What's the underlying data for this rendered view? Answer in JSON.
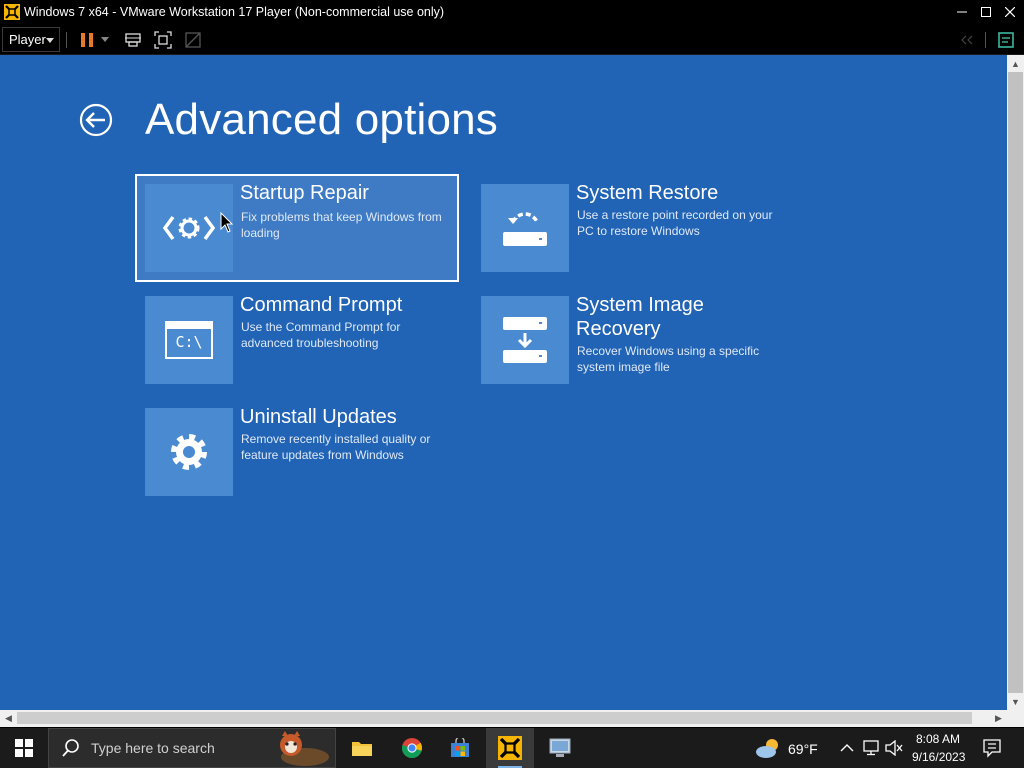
{
  "window": {
    "title": "Windows 7 x64 - VMware Workstation 17 Player (Non-commercial use only)"
  },
  "toolbar": {
    "player_label": "Player"
  },
  "screen": {
    "title": "Advanced options",
    "tiles": [
      {
        "title": "Startup Repair",
        "desc": "Fix problems that keep Windows from loading",
        "icon": "startup-repair-icon"
      },
      {
        "title": "System Restore",
        "desc": "Use a restore point recorded on your PC to restore Windows",
        "icon": "system-restore-icon"
      },
      {
        "title": "Command Prompt",
        "desc": "Use the Command Prompt for advanced troubleshooting",
        "icon": "command-prompt-icon",
        "icon_text": "C:\\"
      },
      {
        "title": "System Image Recovery",
        "desc": "Recover Windows using a specific system image file",
        "icon": "system-image-icon"
      },
      {
        "title": "Uninstall Updates",
        "desc": "Remove recently installed quality or feature updates from Windows",
        "icon": "gear-icon"
      }
    ]
  },
  "taskbar": {
    "search_placeholder": "Type here to search",
    "weather": "69°F",
    "time": "8:08 AM",
    "date": "9/16/2023"
  },
  "colors": {
    "vm_background": "#2163b5",
    "tile_icon_bg": "#4a8ad0",
    "taskbar": "#1b1b1b"
  }
}
